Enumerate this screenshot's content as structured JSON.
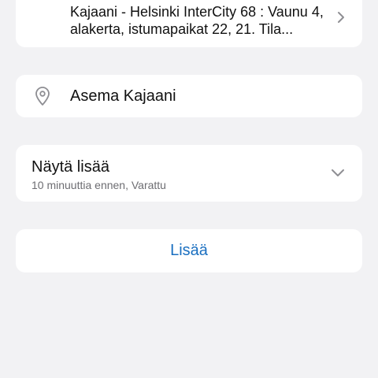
{
  "event": {
    "description": "Kajaani - Helsinki InterCity 68 : Vaunu 4, alakerta, istumapaikat 22, 21. Tila..."
  },
  "location": {
    "icon": "location-pin-icon",
    "text": "Asema Kajaani"
  },
  "more": {
    "title": "Näytä lisää",
    "subtitle": "10 minuuttia ennen, Varattu",
    "icon": "chevron-down-icon"
  },
  "actions": {
    "add_label": "Lisää"
  },
  "colors": {
    "background": "#f2f2f4",
    "card": "#ffffff",
    "accent": "#1a6fc0",
    "secondary_text": "#6d6d72"
  }
}
